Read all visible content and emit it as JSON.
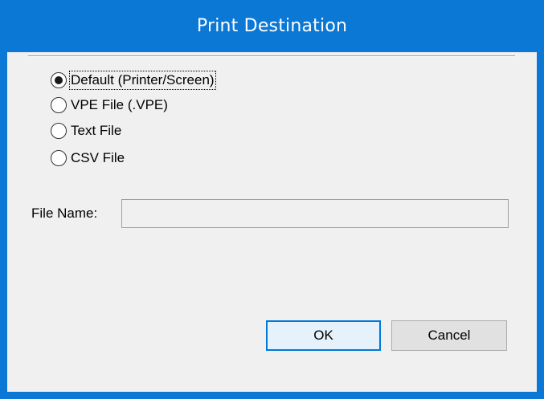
{
  "window": {
    "title": "Print Destination",
    "accent_color": "#0a78d4"
  },
  "destinations": [
    {
      "label": "Default (Printer/Screen)",
      "selected": true
    },
    {
      "label": "VPE File (.VPE)",
      "selected": false
    },
    {
      "label": "Text File",
      "selected": false
    },
    {
      "label": "CSV File",
      "selected": false
    }
  ],
  "file_name": {
    "label": "File Name:",
    "value": "",
    "enabled": false
  },
  "buttons": {
    "ok_label": "OK",
    "cancel_label": "Cancel",
    "default": "OK"
  }
}
